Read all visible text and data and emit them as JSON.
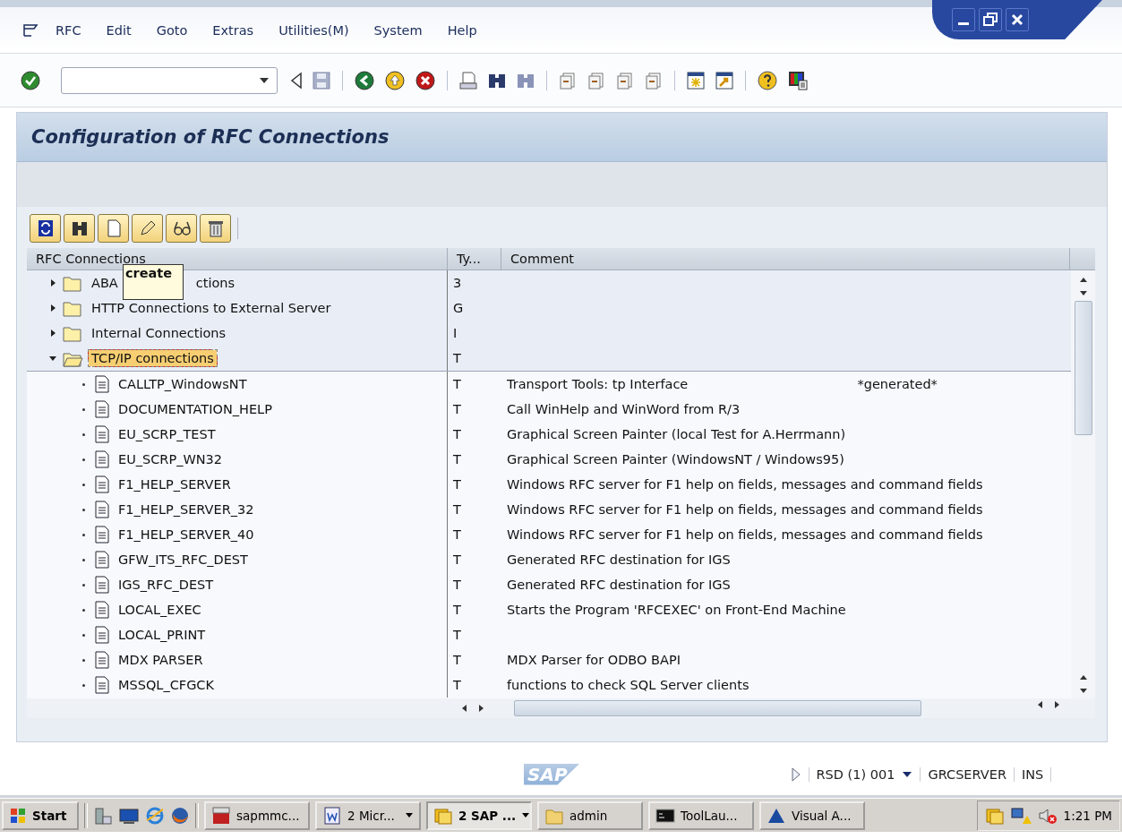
{
  "menu": [
    {
      "label": "RFC"
    },
    {
      "label": "Edit"
    },
    {
      "label": "Goto"
    },
    {
      "label": "Extras"
    },
    {
      "label": "Utilities(M)"
    },
    {
      "label": "System"
    },
    {
      "label": "Help"
    }
  ],
  "screen": {
    "title": "Configuration of RFC Connections"
  },
  "tooltip": {
    "text": "create"
  },
  "tree": {
    "columns": [
      "RFC Connections",
      "Ty...",
      "Comment"
    ],
    "nodes": [
      {
        "kind": "folder",
        "label": "ABA",
        "label_tail": "ctions",
        "type": "3",
        "expanded": false,
        "selected": false
      },
      {
        "kind": "folder",
        "label": "HTTP Connections to External Server",
        "type": "G",
        "expanded": false,
        "selected": false
      },
      {
        "kind": "folder",
        "label": "Internal Connections",
        "type": "I",
        "expanded": false,
        "selected": false
      },
      {
        "kind": "folder",
        "label": "TCP/IP connections",
        "type": "T",
        "expanded": true,
        "selected": true,
        "children": [
          {
            "kind": "leaf",
            "label": "CALLTP_WindowsNT",
            "type": "T",
            "comment": "Transport Tools: tp Interface",
            "comment_2": "*generated*",
            "selected": false
          },
          {
            "kind": "leaf",
            "label": "DOCUMENTATION_HELP",
            "type": "T",
            "comment": "Call WinHelp and WinWord from R/3",
            "selected": false
          },
          {
            "kind": "leaf",
            "label": "EU_SCRP_TEST",
            "type": "T",
            "comment": "Graphical Screen Painter (local Test for A.Herrmann)",
            "selected": false
          },
          {
            "kind": "leaf",
            "label": "EU_SCRP_WN32",
            "type": "T",
            "comment": "Graphical Screen Painter (WindowsNT / Windows95)",
            "selected": false
          },
          {
            "kind": "leaf",
            "label": "F1_HELP_SERVER",
            "type": "T",
            "comment": "Windows RFC server for F1 help on fields, messages and command fields",
            "selected": false
          },
          {
            "kind": "leaf",
            "label": "F1_HELP_SERVER_32",
            "type": "T",
            "comment": "Windows RFC server for F1 help on fields, messages and command fields",
            "selected": false
          },
          {
            "kind": "leaf",
            "label": "F1_HELP_SERVER_40",
            "type": "T",
            "comment": "Windows RFC server for F1 help on fields, messages and command fields",
            "selected": false
          },
          {
            "kind": "leaf",
            "label": "GFW_ITS_RFC_DEST",
            "type": "T",
            "comment": "Generated RFC destination for IGS",
            "selected": false
          },
          {
            "kind": "leaf",
            "label": "IGS_RFC_DEST",
            "type": "T",
            "comment": "Generated RFC destination for IGS",
            "selected": false
          },
          {
            "kind": "leaf",
            "label": "LOCAL_EXEC",
            "type": "T",
            "comment": "Starts the Program 'RFCEXEC' on Front-End Machine",
            "selected": false
          },
          {
            "kind": "leaf",
            "label": "LOCAL_PRINT",
            "type": "T",
            "selected": false
          },
          {
            "kind": "leaf",
            "label": "MDX PARSER",
            "type": "T",
            "comment": "MDX Parser for ODBO BAPI",
            "selected": false
          },
          {
            "kind": "leaf",
            "label": "MSSQL_CFGCK",
            "type": "T",
            "comment": "functions to check SQL Server clients",
            "selected": false
          }
        ]
      }
    ]
  },
  "status_bar": {
    "logo": "SAP",
    "system": "RSD (1) 001",
    "server": "GRCSERVER",
    "mode": "INS"
  },
  "taskbar": {
    "start": "Start",
    "tasks": [
      {
        "label": "sapmmc...",
        "grouped": false,
        "selected": false
      },
      {
        "label": "2 Micr...",
        "grouped": true,
        "selected": false
      },
      {
        "label": "2 SAP ...",
        "grouped": true,
        "selected": true
      },
      {
        "label": "admin",
        "grouped": false,
        "selected": false
      },
      {
        "label": "ToolLau...",
        "grouped": false,
        "selected": false
      },
      {
        "label": "Visual A...",
        "grouped": false,
        "selected": false
      }
    ],
    "clock": "1:21 PM"
  }
}
